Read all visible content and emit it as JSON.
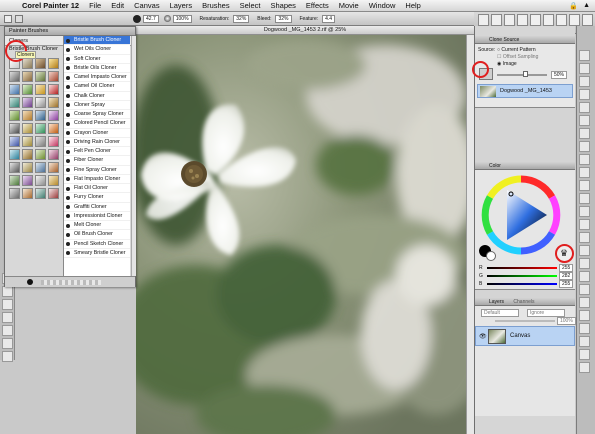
{
  "menubar": {
    "app_name": "Corel Painter 12",
    "items": [
      "File",
      "Edit",
      "Canvas",
      "Layers",
      "Brushes",
      "Select",
      "Shapes",
      "Effects",
      "Movie",
      "Window",
      "Help"
    ]
  },
  "propbar": {
    "size_value": "42.7",
    "opacity_value": "100%",
    "resaturation_label": "Resaturation:",
    "resaturation_value": "32%",
    "bleed_label": "Bleed:",
    "bleed_value": "32%",
    "feature_label": "Feature:",
    "feature_value": "4.4"
  },
  "brush_panel": {
    "title": "Painter Brushes",
    "category_label": "Cloners",
    "selected_variant": "Bristle Brush Cloner",
    "category_tooltip": "Cloners",
    "variants": [
      "Bristle Brush Cloner",
      "Wet Oils Cloner",
      "Soft Cloner",
      "Bristle Oils Cloner",
      "Camel Impasto Cloner",
      "Camel Oil Cloner",
      "Chalk Cloner",
      "Cloner Spray",
      "Coarse Spray Cloner",
      "Colored Pencil Cloner",
      "Crayon Cloner",
      "Driving Rain Cloner",
      "Felt Pen Cloner",
      "Fiber Cloner",
      "Fine Spray Cloner",
      "Flat Impasto Cloner",
      "Flat Oil Cloner",
      "Furry Cloner",
      "Graffiti Cloner",
      "Impressionist Cloner",
      "Melt Cloner",
      "Oil Brush Cloner",
      "Pencil Sketch Cloner",
      "Smeary Bristle Cloner"
    ]
  },
  "document": {
    "title": "Dogwood _MG_1453 2.rif @ 25%"
  },
  "clone_source": {
    "panel_title": "Clone Source",
    "source_label": "Source:",
    "opt_current_pattern": "Current Pattern",
    "opt_offset_sampling": "Offset Sampling",
    "opt_image": "Image",
    "zoom_value": "50%",
    "source_name": "Dogwood _MG_1453"
  },
  "color_panel": {
    "title": "Color",
    "channels": [
      {
        "label": "R",
        "value": "255"
      },
      {
        "label": "G",
        "value": "282"
      },
      {
        "label": "B",
        "value": "255"
      }
    ],
    "colors": {
      "selected": "#2f6ee0",
      "primary": "#000000",
      "secondary": "#ffffff"
    }
  },
  "layers_panel": {
    "title": "Layers",
    "tab2": "Channels",
    "composite_method": "Default",
    "preserve": "Ignore",
    "opacity_value": "100%",
    "layer_name": "Canvas"
  }
}
